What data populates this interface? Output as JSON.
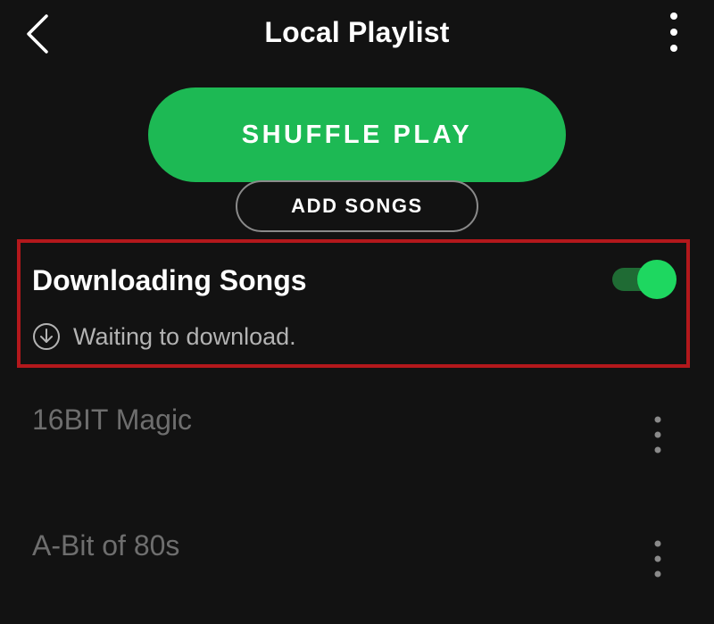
{
  "header": {
    "title": "Local Playlist",
    "back_icon": "chevron-left-icon",
    "more_icon": "vertical-ellipsis-icon"
  },
  "actions": {
    "shuffle_label": "SHUFFLE PLAY",
    "add_songs_label": "ADD SONGS"
  },
  "download": {
    "title": "Downloading Songs",
    "toggle_on": true,
    "status_icon": "download-circle-icon",
    "status_text": "Waiting to download."
  },
  "songs": [
    {
      "title": "16BIT Magic"
    },
    {
      "title": "A-Bit of 80s"
    }
  ],
  "colors": {
    "background": "#121212",
    "accent_green": "#1db954",
    "highlight_red": "#b3181c"
  }
}
